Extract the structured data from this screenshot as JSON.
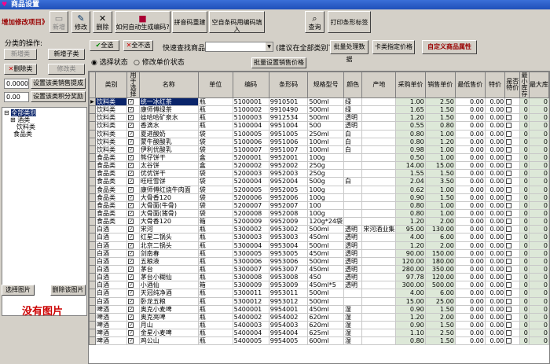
{
  "window": {
    "title": "商品设置",
    "icon": "heart-icon"
  },
  "toolbar": {
    "add_section": "增加修改项目》",
    "buttons": [
      {
        "label": "新增",
        "icon": "new-doc-icon",
        "glyph": "▭",
        "disabled": true
      },
      {
        "label": "修改",
        "icon": "edit-icon",
        "glyph": "✎",
        "disabled": false
      },
      {
        "label": "删除",
        "icon": "delete-icon",
        "glyph": "✕",
        "disabled": false
      },
      {
        "label": "如何自动生成编码?",
        "icon": "book-icon",
        "glyph": "📕",
        "disabled": false
      },
      {
        "label": "拼音码重建",
        "icon": "",
        "glyph": "",
        "disabled": false
      },
      {
        "label": "空自条码用编码填入",
        "icon": "",
        "glyph": "",
        "disabled": false
      },
      {
        "label": "查询",
        "icon": "binoculars-icon",
        "glyph": "⌕",
        "disabled": false
      },
      {
        "label": "打印条形标签",
        "icon": "",
        "glyph": "",
        "disabled": false
      }
    ]
  },
  "left": {
    "category_ops": "分类的操作:",
    "new_category": "新增类",
    "new_subcategory": "新增子类",
    "delete_category": "删除类",
    "edit_category": "修改类",
    "sale_price_value": "0.0000",
    "set_sale_price": "设置该类销售提成",
    "points_value": "0.00",
    "set_points": "设置该类积分奖励",
    "tree": {
      "root": "全部类别",
      "children": [
        "酒类",
        "饮料类",
        "食品类"
      ]
    },
    "select_image": "选择图片",
    "delete_image": "删除该图片",
    "no_image": "没有图片"
  },
  "controls": {
    "select_all": "全选",
    "select_none": "全不选",
    "quick_find_label": "快速查找商品:",
    "find_hint": "(建议在全部类别下)",
    "batch_process": "批量处理数据",
    "card_price": "卡类指定价格",
    "custom_attr": "自定义商品属性",
    "radio_select": "选择状态",
    "radio_price": "修改单价状态",
    "batch_price": "批量设置销售价格"
  },
  "table": {
    "headers": [
      "类别",
      "用于选择",
      "名称",
      "单位",
      "编码",
      "条形码",
      "规格型号",
      "颜色",
      "产地",
      "采购单价",
      "销售单价",
      "最低售价",
      "特价",
      "是否特价",
      "最小库存",
      "最大库"
    ],
    "rows": [
      [
        "饮料类",
        "统一冰红茶",
        "瓶",
        "5100001",
        "9910501",
        "500ml",
        "绿",
        "",
        "1.00",
        "2.50",
        "0.00",
        "0.00"
      ],
      [
        "饮料类",
        "康师傅绿茶",
        "瓶",
        "5100002",
        "9910490",
        "500ml",
        "绿",
        "",
        "1.65",
        "1.50",
        "0.00",
        "0.00"
      ],
      [
        "饮料类",
        "娃哈哈矿泉水",
        "瓶",
        "5100003",
        "9912534",
        "500ml",
        "透明",
        "",
        "1.20",
        "1.50",
        "0.00",
        "0.00"
      ],
      [
        "饮料类",
        "香滴水",
        "瓶",
        "5100004",
        "9951004",
        "500",
        "透明",
        "",
        "0.55",
        "0.80",
        "0.00",
        "0.00"
      ],
      [
        "饮料类",
        "夏进酸奶",
        "袋",
        "5100005",
        "9951005",
        "250ml",
        "白",
        "",
        "0.80",
        "1.00",
        "0.00",
        "0.00"
      ],
      [
        "饮料类",
        "蒙牛酸酸乳",
        "袋",
        "5100006",
        "9951006",
        "100ml",
        "白",
        "",
        "0.80",
        "1.20",
        "0.00",
        "0.00"
      ],
      [
        "饮料类",
        "伊利优酸乳",
        "袋",
        "5100007",
        "9951007",
        "100ml",
        "白",
        "",
        "0.98",
        "1.00",
        "0.00",
        "0.00"
      ],
      [
        "食品类",
        "熊仔饼干",
        "盒",
        "5200001",
        "9952001",
        "100g",
        "",
        "",
        "0.50",
        "1.00",
        "0.00",
        "0.00"
      ],
      [
        "食品类",
        "太谷饼",
        "盒",
        "5200002",
        "9952002",
        "250g",
        "",
        "",
        "14.00",
        "15.00",
        "0.00",
        "0.00"
      ],
      [
        "食品类",
        "优优饼干",
        "袋",
        "5200003",
        "9952003",
        "250g",
        "",
        "",
        "1.55",
        "1.50",
        "0.00",
        "0.00"
      ],
      [
        "食品类",
        "旺旺雪饼",
        "袋",
        "5200004",
        "9952004",
        "500g",
        "白",
        "",
        "2.04",
        "3.50",
        "0.00",
        "0.00"
      ],
      [
        "食品类",
        "康师傅红烧牛肉面",
        "袋",
        "5200005",
        "9952005",
        "100g",
        "",
        "",
        "0.62",
        "1.00",
        "0.00",
        "0.00"
      ],
      [
        "食品类",
        "大骨香120",
        "袋",
        "5200006",
        "9952006",
        "100g",
        "",
        "",
        "0.90",
        "1.50",
        "0.00",
        "0.00"
      ],
      [
        "食品类",
        "大骨面(牛骨)",
        "袋",
        "5200007",
        "9952007",
        "100",
        "",
        "",
        "0.80",
        "1.00",
        "0.00",
        "0.00"
      ],
      [
        "食品类",
        "大骨面(猪骨)",
        "袋",
        "5200008",
        "9952008",
        "100g",
        "",
        "",
        "0.80",
        "1.00",
        "0.00",
        "0.00"
      ],
      [
        "食品类",
        "大骨香120",
        "箱",
        "5200009",
        "9952009",
        "120g*24袋",
        "",
        "",
        "1.20",
        "2.00",
        "0.00",
        "0.00"
      ],
      [
        "白酒",
        "宋河",
        "瓶",
        "5300002",
        "9953002",
        "500ml",
        "透明",
        "宋河酒业集",
        "95.00",
        "130.00",
        "0.00",
        "0.00"
      ],
      [
        "白酒",
        "红星二锅头",
        "瓶",
        "5300003",
        "9953003",
        "450ml",
        "透明",
        "",
        "4.00",
        "6.00",
        "0.00",
        "0.00"
      ],
      [
        "白酒",
        "北京二锅头",
        "瓶",
        "5300004",
        "9953004",
        "500ml",
        "透明",
        "",
        "1.20",
        "2.00",
        "0.00",
        "0.00"
      ],
      [
        "白酒",
        "剑南春",
        "瓶",
        "5300005",
        "9953005",
        "450ml",
        "透明",
        "",
        "90.00",
        "150.00",
        "0.00",
        "0.00"
      ],
      [
        "白酒",
        "五粮液",
        "瓶",
        "5300006",
        "9953006",
        "500ml",
        "透明",
        "",
        "120.00",
        "180.00",
        "0.00",
        "0.00"
      ],
      [
        "白酒",
        "茅台",
        "瓶",
        "5300007",
        "9953007",
        "450ml",
        "透明",
        "",
        "280.00",
        "350.00",
        "0.00",
        "0.00"
      ],
      [
        "白酒",
        "茅台小糊仙",
        "瓶",
        "5300008",
        "9953008",
        "450",
        "透明",
        "",
        "97.78",
        "120.00",
        "0.00",
        "0.00"
      ],
      [
        "白酒",
        "小酒仙",
        "箱",
        "5300009",
        "9953009",
        "450ml*5",
        "透明",
        "",
        "300.00",
        "500.00",
        "0.00",
        "0.00"
      ],
      [
        "白酒",
        "天冠纯净酒",
        "瓶",
        "5300011",
        "9953011",
        "500ml",
        "",
        "",
        "4.00",
        "6.00",
        "0.00",
        "0.00"
      ],
      [
        "白酒",
        "卧龙五粮",
        "瓶",
        "5300012",
        "9953012",
        "500ml",
        "",
        "",
        "15.00",
        "25.00",
        "0.00",
        "0.00"
      ],
      [
        "啤酒",
        "奥克小麦啤",
        "瓶",
        "5400001",
        "9954001",
        "450ml",
        "湿",
        "",
        "0.90",
        "1.50",
        "0.00",
        "0.00"
      ],
      [
        "啤酒",
        "奥克亮啤",
        "瓶",
        "5400002",
        "9954002",
        "620ml",
        "湿",
        "",
        "1.20",
        "2.00",
        "0.00",
        "0.00"
      ],
      [
        "啤酒",
        "月山",
        "瓶",
        "5400003",
        "9954003",
        "620ml",
        "湿",
        "",
        "0.90",
        "1.50",
        "0.00",
        "0.00"
      ],
      [
        "啤酒",
        "金星小麦啤",
        "瓶",
        "5400004",
        "9954004",
        "625ml",
        "湿",
        "",
        "1.10",
        "2.50",
        "0.00",
        "0.00"
      ],
      [
        "啤酒",
        "鸡公山",
        "瓶",
        "5400005",
        "9954005",
        "600ml",
        "湿",
        "",
        "0.80",
        "1.50",
        "0.00",
        "0.00"
      ]
    ]
  }
}
